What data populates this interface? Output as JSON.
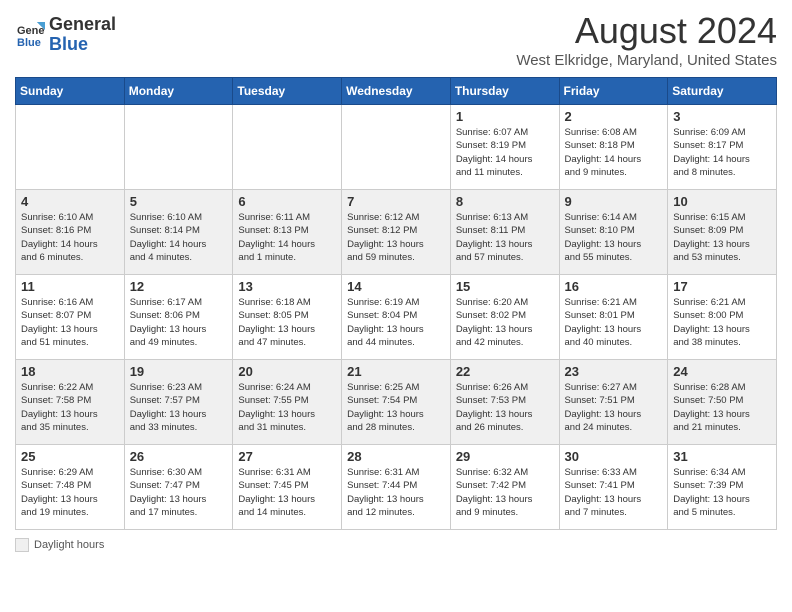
{
  "header": {
    "logo_line1": "General",
    "logo_line2": "Blue",
    "month_title": "August 2024",
    "subtitle": "West Elkridge, Maryland, United States"
  },
  "days_of_week": [
    "Sunday",
    "Monday",
    "Tuesday",
    "Wednesday",
    "Thursday",
    "Friday",
    "Saturday"
  ],
  "weeks": [
    [
      {
        "day": "",
        "info": ""
      },
      {
        "day": "",
        "info": ""
      },
      {
        "day": "",
        "info": ""
      },
      {
        "day": "",
        "info": ""
      },
      {
        "day": "1",
        "info": "Sunrise: 6:07 AM\nSunset: 8:19 PM\nDaylight: 14 hours\nand 11 minutes."
      },
      {
        "day": "2",
        "info": "Sunrise: 6:08 AM\nSunset: 8:18 PM\nDaylight: 14 hours\nand 9 minutes."
      },
      {
        "day": "3",
        "info": "Sunrise: 6:09 AM\nSunset: 8:17 PM\nDaylight: 14 hours\nand 8 minutes."
      }
    ],
    [
      {
        "day": "4",
        "info": "Sunrise: 6:10 AM\nSunset: 8:16 PM\nDaylight: 14 hours\nand 6 minutes."
      },
      {
        "day": "5",
        "info": "Sunrise: 6:10 AM\nSunset: 8:14 PM\nDaylight: 14 hours\nand 4 minutes."
      },
      {
        "day": "6",
        "info": "Sunrise: 6:11 AM\nSunset: 8:13 PM\nDaylight: 14 hours\nand 1 minute."
      },
      {
        "day": "7",
        "info": "Sunrise: 6:12 AM\nSunset: 8:12 PM\nDaylight: 13 hours\nand 59 minutes."
      },
      {
        "day": "8",
        "info": "Sunrise: 6:13 AM\nSunset: 8:11 PM\nDaylight: 13 hours\nand 57 minutes."
      },
      {
        "day": "9",
        "info": "Sunrise: 6:14 AM\nSunset: 8:10 PM\nDaylight: 13 hours\nand 55 minutes."
      },
      {
        "day": "10",
        "info": "Sunrise: 6:15 AM\nSunset: 8:09 PM\nDaylight: 13 hours\nand 53 minutes."
      }
    ],
    [
      {
        "day": "11",
        "info": "Sunrise: 6:16 AM\nSunset: 8:07 PM\nDaylight: 13 hours\nand 51 minutes."
      },
      {
        "day": "12",
        "info": "Sunrise: 6:17 AM\nSunset: 8:06 PM\nDaylight: 13 hours\nand 49 minutes."
      },
      {
        "day": "13",
        "info": "Sunrise: 6:18 AM\nSunset: 8:05 PM\nDaylight: 13 hours\nand 47 minutes."
      },
      {
        "day": "14",
        "info": "Sunrise: 6:19 AM\nSunset: 8:04 PM\nDaylight: 13 hours\nand 44 minutes."
      },
      {
        "day": "15",
        "info": "Sunrise: 6:20 AM\nSunset: 8:02 PM\nDaylight: 13 hours\nand 42 minutes."
      },
      {
        "day": "16",
        "info": "Sunrise: 6:21 AM\nSunset: 8:01 PM\nDaylight: 13 hours\nand 40 minutes."
      },
      {
        "day": "17",
        "info": "Sunrise: 6:21 AM\nSunset: 8:00 PM\nDaylight: 13 hours\nand 38 minutes."
      }
    ],
    [
      {
        "day": "18",
        "info": "Sunrise: 6:22 AM\nSunset: 7:58 PM\nDaylight: 13 hours\nand 35 minutes."
      },
      {
        "day": "19",
        "info": "Sunrise: 6:23 AM\nSunset: 7:57 PM\nDaylight: 13 hours\nand 33 minutes."
      },
      {
        "day": "20",
        "info": "Sunrise: 6:24 AM\nSunset: 7:55 PM\nDaylight: 13 hours\nand 31 minutes."
      },
      {
        "day": "21",
        "info": "Sunrise: 6:25 AM\nSunset: 7:54 PM\nDaylight: 13 hours\nand 28 minutes."
      },
      {
        "day": "22",
        "info": "Sunrise: 6:26 AM\nSunset: 7:53 PM\nDaylight: 13 hours\nand 26 minutes."
      },
      {
        "day": "23",
        "info": "Sunrise: 6:27 AM\nSunset: 7:51 PM\nDaylight: 13 hours\nand 24 minutes."
      },
      {
        "day": "24",
        "info": "Sunrise: 6:28 AM\nSunset: 7:50 PM\nDaylight: 13 hours\nand 21 minutes."
      }
    ],
    [
      {
        "day": "25",
        "info": "Sunrise: 6:29 AM\nSunset: 7:48 PM\nDaylight: 13 hours\nand 19 minutes."
      },
      {
        "day": "26",
        "info": "Sunrise: 6:30 AM\nSunset: 7:47 PM\nDaylight: 13 hours\nand 17 minutes."
      },
      {
        "day": "27",
        "info": "Sunrise: 6:31 AM\nSunset: 7:45 PM\nDaylight: 13 hours\nand 14 minutes."
      },
      {
        "day": "28",
        "info": "Sunrise: 6:31 AM\nSunset: 7:44 PM\nDaylight: 13 hours\nand 12 minutes."
      },
      {
        "day": "29",
        "info": "Sunrise: 6:32 AM\nSunset: 7:42 PM\nDaylight: 13 hours\nand 9 minutes."
      },
      {
        "day": "30",
        "info": "Sunrise: 6:33 AM\nSunset: 7:41 PM\nDaylight: 13 hours\nand 7 minutes."
      },
      {
        "day": "31",
        "info": "Sunrise: 6:34 AM\nSunset: 7:39 PM\nDaylight: 13 hours\nand 5 minutes."
      }
    ]
  ],
  "footer": {
    "daylight_label": "Daylight hours"
  }
}
